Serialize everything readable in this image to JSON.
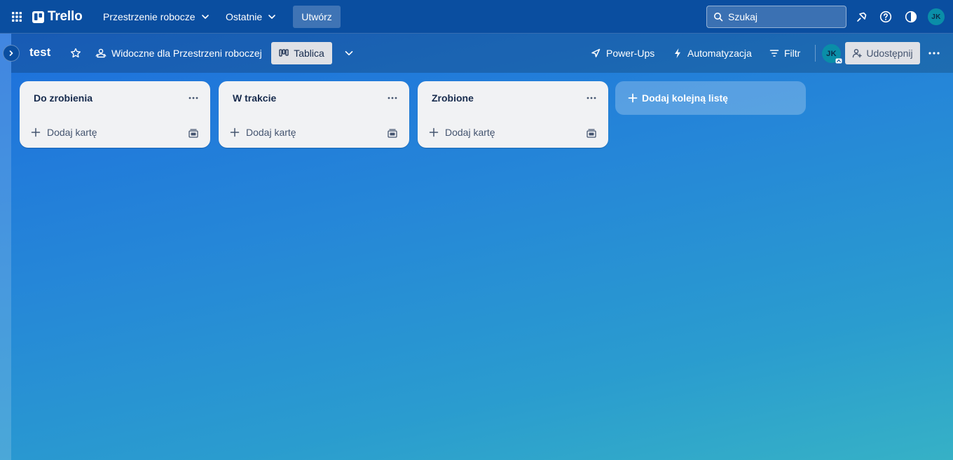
{
  "header": {
    "logo_text": "Trello",
    "nav": [
      {
        "label": "Przestrzenie robocze"
      },
      {
        "label": "Ostatnie"
      }
    ],
    "create_label": "Utwórz",
    "search_placeholder": "Szukaj",
    "avatar_initials": "JK"
  },
  "board": {
    "title": "test",
    "visibility_label": "Widoczne dla Przestrzeni roboczej",
    "view_label": "Tablica",
    "power_ups_label": "Power-Ups",
    "automation_label": "Automatyzacja",
    "filter_label": "Filtr",
    "member_initials": "JK",
    "share_label": "Udostępnij"
  },
  "lists": [
    {
      "title": "Do zrobienia",
      "add_card_label": "Dodaj kartę"
    },
    {
      "title": "W trakcie",
      "add_card_label": "Dodaj kartę"
    },
    {
      "title": "Zrobione",
      "add_card_label": "Dodaj kartę"
    }
  ],
  "add_list_label": "Dodaj kolejną listę",
  "colors": {
    "header_bg": "#0a4ea0",
    "list_bg": "#f1f2f4",
    "button_bg": "#dfe1e6",
    "avatar_bg": "#0a8ea8"
  }
}
